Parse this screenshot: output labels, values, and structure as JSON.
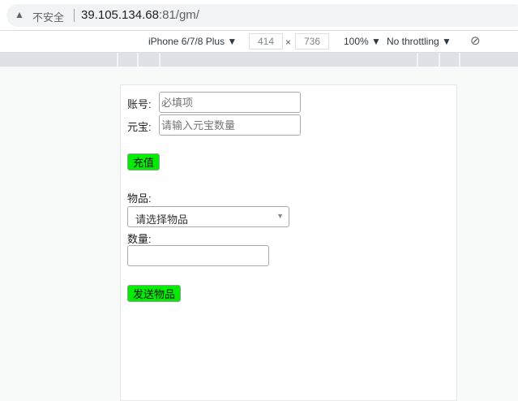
{
  "browser": {
    "security_label": "不安全",
    "url_host": "39.105.134.68",
    "url_rest": ":81/gm/"
  },
  "devtools": {
    "device": "iPhone 6/7/8 Plus ▼",
    "width": "414",
    "x": "×",
    "height": "736",
    "zoom": "100% ▼",
    "throttling": "No throttling ▼"
  },
  "form": {
    "account_label": "账号:",
    "account_placeholder": "必填项",
    "yuanbao_label": "元宝:",
    "yuanbao_placeholder": "请输入元宝数量",
    "recharge_button": "充值",
    "item_label": "物品:",
    "item_select": "请选择物品",
    "qty_label": "数量:",
    "qty_value": "",
    "send_button": "发送物品"
  }
}
